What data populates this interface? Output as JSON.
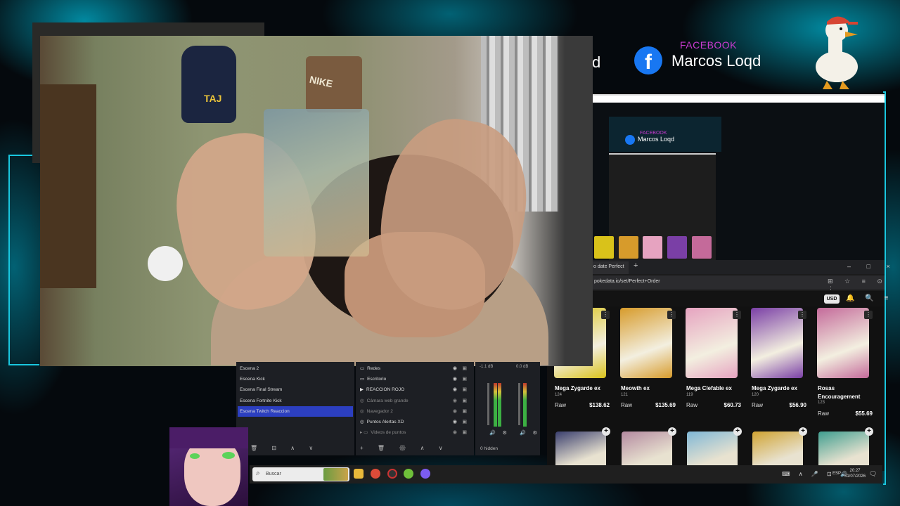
{
  "facebook": {
    "partial_text": "d",
    "logo_letter": "f",
    "label": "FACEBOOK",
    "name": "Marcos Loqd"
  },
  "nested": {
    "label": "FACEBOOK",
    "name": "Marcos Loqd"
  },
  "browser": {
    "tab_title": "o date Perfect",
    "new_tab": "+",
    "window_controls": "– □ ×",
    "url": "pokedata.io/set/Perfect+Order",
    "url_icons": "⊞ ☆ ≡ ⊙ ⋮",
    "currency": "USD",
    "header_icons": "🔔 🔍 ≡"
  },
  "cards": [
    {
      "name": "Mega Zygarde ex",
      "num": "124",
      "cond": "Raw",
      "price": "$138.62",
      "color": "#d9c21a"
    },
    {
      "name": "Meowth ex",
      "num": "121",
      "cond": "Raw",
      "price": "$135.69",
      "color": "#d79b2b"
    },
    {
      "name": "Mega Clefable ex",
      "num": "119",
      "cond": "Raw",
      "price": "$60.73",
      "color": "#e6a3c0"
    },
    {
      "name": "Mega Zygarde ex",
      "num": "120",
      "cond": "Raw",
      "price": "$56.90",
      "color": "#7a3fa6"
    },
    {
      "name": "Rosas Encouragement",
      "num": "123",
      "cond": "Raw",
      "price": "$55.69",
      "color": "#c46a9a"
    }
  ],
  "cards_row2": [
    {
      "color": "#3a3f6e"
    },
    {
      "color": "#b48aa0"
    },
    {
      "color": "#7fb7d6"
    },
    {
      "color": "#d0a332"
    },
    {
      "color": "#3f9e8f"
    }
  ],
  "webcam": {
    "backpack_text": "TAJ",
    "bag_text": "NIKE"
  },
  "obs": {
    "scenes": [
      "Escena 2",
      "Escena Kick",
      "Escena Final Stream",
      "Escena Fortnite Kick",
      "Escena Twitch Reaccion"
    ],
    "active_scene": "Escena Twitch Reaccion",
    "scene_toolbar": "🗑 ⊟ ∧ ∨",
    "sources": [
      {
        "icon": "▭",
        "name": "Redes",
        "visible": true
      },
      {
        "icon": "▭",
        "name": "Escritorio",
        "visible": true
      },
      {
        "icon": "▶",
        "name": "REACCION ROJO",
        "visible": true
      },
      {
        "icon": "◎",
        "name": "Cámara web grande",
        "visible": false
      },
      {
        "icon": "◎",
        "name": "Navegador 2",
        "visible": false
      },
      {
        "icon": "◎",
        "name": "Puntos Alertas XD",
        "visible": true
      },
      {
        "icon": "▸ ▭",
        "name": "Videos de puntos",
        "visible": false
      }
    ],
    "sources_toolbar": "+ 🗑 ⚙ ∧ ∨",
    "mixer": {
      "db1": "-1.1 dB",
      "db2": "0.0 dB",
      "ctrl": "🔊 ⚙",
      "footer": "0 hidden"
    }
  },
  "taskbar": {
    "search_icon": "⌕",
    "search_placeholder": "Buscar",
    "tray_icons": "⌨ ∧ 🎤 ⊡ 🔊",
    "language": "ESP",
    "time": "20:27",
    "date": "31/07/2026",
    "notif": "🗨"
  },
  "colors": {
    "accent": "#19c7df",
    "facebook": "#1877f2",
    "facebook_label": "#c93bd1",
    "obs_active": "#2c3fc0"
  }
}
